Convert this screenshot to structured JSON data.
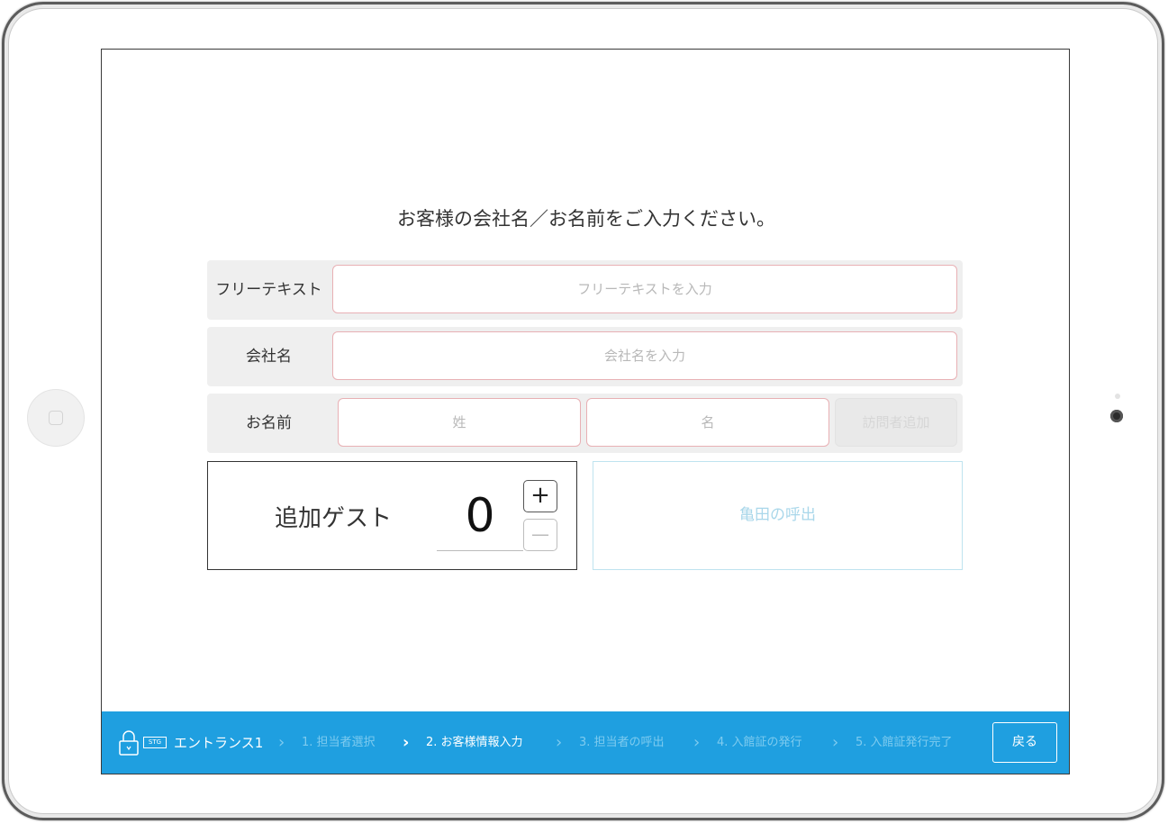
{
  "prompt": "お客様の会社名／お名前をご入力ください。",
  "form": {
    "free_text": {
      "label": "フリーテキスト",
      "placeholder": "フリーテキストを入力"
    },
    "company": {
      "label": "会社名",
      "placeholder": "会社名を入力"
    },
    "name": {
      "label": "お名前",
      "last_placeholder": "姓",
      "first_placeholder": "名",
      "add_visitor_label": "訪問者追加"
    }
  },
  "guest": {
    "label": "追加ゲスト",
    "count": "0",
    "plus": "+",
    "minus": "—"
  },
  "call_button": {
    "label": "亀田の呼出"
  },
  "footer": {
    "stg_badge": "STG",
    "entrance": "エントランス1",
    "steps": [
      {
        "label": "1. 担当者選択",
        "active": false
      },
      {
        "label": "2. お客様情報入力",
        "active": true
      },
      {
        "label": "3. 担当者の呼出",
        "active": false
      },
      {
        "label": "4. 入館証の発行",
        "active": false
      },
      {
        "label": "5. 入館証発行完了",
        "active": false
      }
    ],
    "chevron": "›",
    "back_label": "戻る"
  },
  "colors": {
    "accent": "#1f9fe0",
    "field_border": "#e8b0b4",
    "call_text": "#a9d7ea"
  }
}
